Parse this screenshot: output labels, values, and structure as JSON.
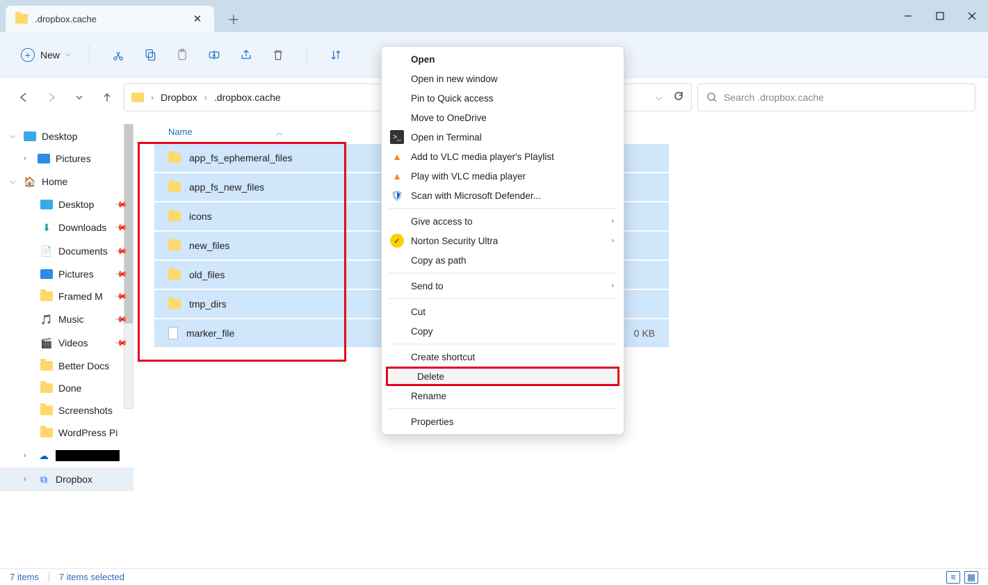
{
  "window": {
    "tab_title": ".dropbox.cache",
    "new_label": "New"
  },
  "breadcrumb": {
    "part1": "Dropbox",
    "part2": ".dropbox.cache"
  },
  "search": {
    "placeholder": "Search .dropbox.cache"
  },
  "sidebar": {
    "desktop": "Desktop",
    "pictures": "Pictures",
    "home": "Home",
    "home_desktop": "Desktop",
    "downloads": "Downloads",
    "documents": "Documents",
    "home_pictures": "Pictures",
    "framed": "Framed M",
    "music": "Music",
    "videos": "Videos",
    "betterdocs": "Better Docs",
    "done": "Done",
    "screenshots": "Screenshots",
    "wordpress": "WordPress Pi",
    "dropbox": "Dropbox"
  },
  "columns": {
    "name": "Name"
  },
  "files": [
    {
      "name": "app_fs_ephemeral_files",
      "type": "folder"
    },
    {
      "name": "app_fs_new_files",
      "type": "folder"
    },
    {
      "name": "icons",
      "type": "folder"
    },
    {
      "name": "new_files",
      "type": "folder"
    },
    {
      "name": "old_files",
      "type": "folder"
    },
    {
      "name": "tmp_dirs",
      "type": "folder"
    },
    {
      "name": "marker_file",
      "type": "doc",
      "size": "0 KB"
    }
  ],
  "context_menu": {
    "open": "Open",
    "open_new": "Open in new window",
    "pin": "Pin to Quick access",
    "onedrive": "Move to OneDrive",
    "terminal": "Open in Terminal",
    "vlc_add": "Add to VLC media player's Playlist",
    "vlc_play": "Play with VLC media player",
    "defender": "Scan with Microsoft Defender...",
    "give_access": "Give access to",
    "norton": "Norton Security Ultra",
    "copy_path": "Copy as path",
    "send_to": "Send to",
    "cut": "Cut",
    "copy": "Copy",
    "shortcut": "Create shortcut",
    "delete": "Delete",
    "rename": "Rename",
    "properties": "Properties"
  },
  "status": {
    "items": "7 items",
    "selected": "7 items selected"
  }
}
